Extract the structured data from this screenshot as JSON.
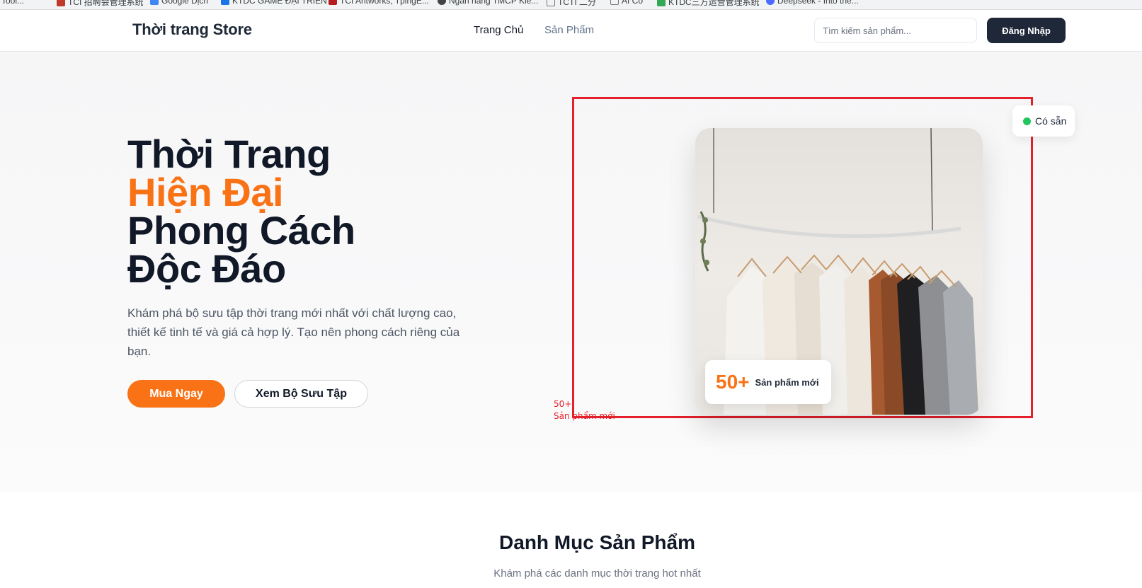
{
  "bookmarks": [
    {
      "label": "Tool..."
    },
    {
      "label": "TCI 招聘会管理系统"
    },
    {
      "label": "Google Dịch"
    },
    {
      "label": "KTDC GAME ĐẠI TRIỂN"
    },
    {
      "label": "TCI Antworks, TpingE..."
    },
    {
      "label": "Ngân hàng TMCP Kiế..."
    },
    {
      "label": "TCTI 二分"
    },
    {
      "label": "AI Co"
    },
    {
      "label": "KTDC三方运营管理系统"
    },
    {
      "label": "Deepseek - Into the..."
    }
  ],
  "nav": {
    "logo": "Thời trang Store",
    "home": "Trang Chủ",
    "products": "Sản Phẩm",
    "search_placeholder": "Tìm kiếm sản phẩm...",
    "login": "Đăng Nhập"
  },
  "hero": {
    "title_line1": "Thời Trang",
    "title_line2": "Hiện Đại",
    "title_line3": "Phong Cách",
    "title_line4": "Độc Đáo",
    "description": "Khám phá bộ sưu tập thời trang mới nhất với chất lượng cao, thiết kế tinh tế và giá cả hợp lý. Tạo nên phong cách riêng của bạn.",
    "cta_primary": "Mua Ngay",
    "cta_secondary": "Xem Bộ Sưu Tập",
    "stat_value": "50+",
    "stat_label": "Sản phẩm mới",
    "status_label": "Có sẵn",
    "debug_value": "50+",
    "debug_label": "Sản phẩm mới"
  },
  "categories": {
    "title": "Danh Mục Sản Phẩm",
    "subtitle": "Khám phá các danh mục thời trang hot nhất"
  },
  "colors": {
    "accent": "#f97316",
    "dark": "#1e2838",
    "status_green": "#22c55e",
    "debug_red": "#e3202b"
  }
}
